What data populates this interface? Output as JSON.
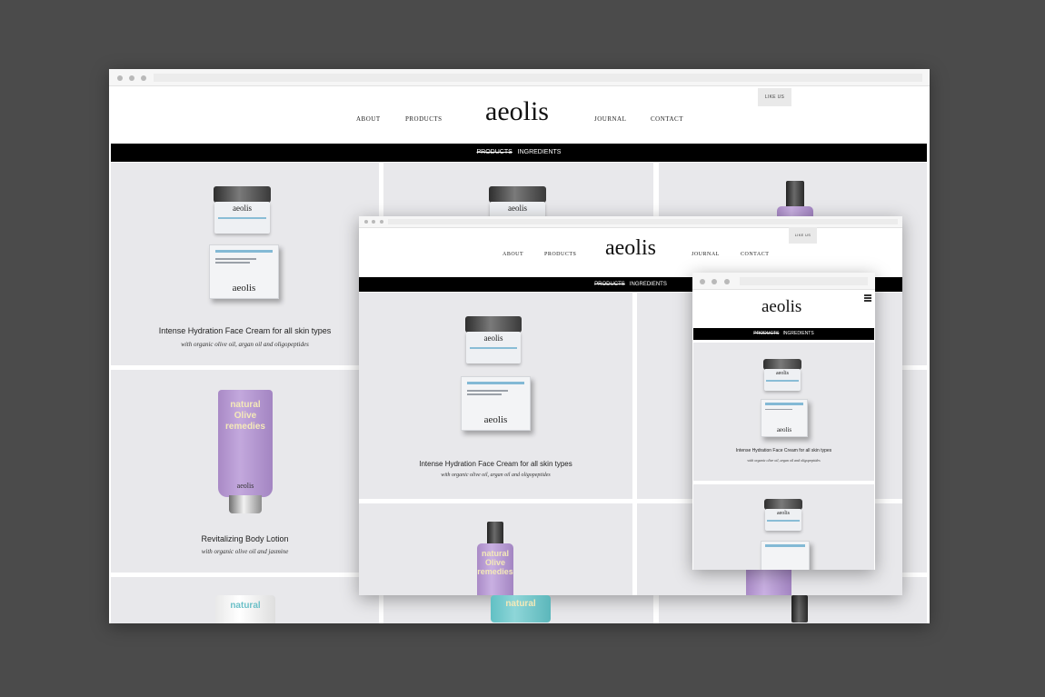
{
  "site": {
    "logo": "aeolis",
    "nav_left": [
      "ABOUT",
      "PRODUCTS"
    ],
    "nav_right": [
      "JOURNAL",
      "CONTACT"
    ],
    "like_button": "LIKE US",
    "subnav": {
      "active": "PRODUCTS",
      "other": "INGREDIENTS"
    }
  },
  "products": [
    {
      "title": "Intense Hydration Face Cream for all skin types",
      "subtitle": "with organic olive oil, argan oil and oligopeptides",
      "jar_label": "aeolis",
      "tube_label": "natural Olive remedies"
    },
    {
      "title": "Revitalizing Body Lotion",
      "subtitle": "with organic olive oil and jasmine",
      "tube_label": "natural Olive remedies"
    }
  ],
  "art": {
    "tube_text": "natural",
    "tube_text2": "Olive",
    "tube_text3": "remedies",
    "brand_small": "aeolis"
  },
  "colors": {
    "background": "#4b4b4b",
    "accent_purple": "#b89ad4",
    "accent_teal": "#61c0c4",
    "bar": "#000000"
  }
}
